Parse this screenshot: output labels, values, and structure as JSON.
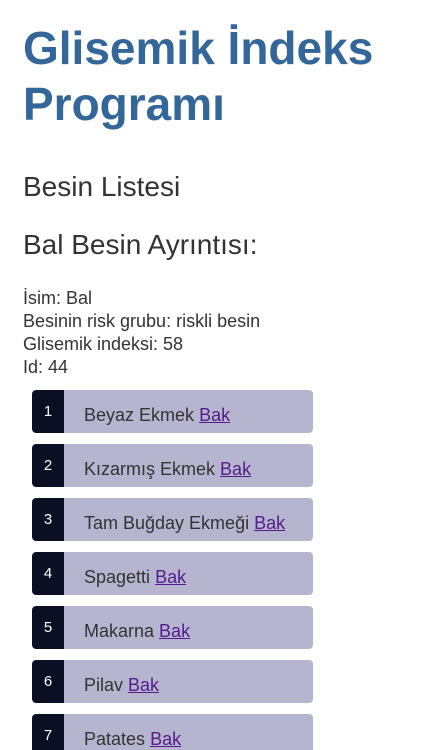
{
  "header": {
    "title": "Glisemik İndeks Programı"
  },
  "sections": {
    "list_heading": "Besin Listesi",
    "detail_heading": "Bal Besin Ayrıntısı:"
  },
  "detail": {
    "name_line": "İsim: Bal",
    "risk_line": "Besinin risk grubu: riskli besin",
    "gi_line": "Glisemik indeksi: 58",
    "id_line": "Id: 44"
  },
  "foods": [
    {
      "num": "1",
      "name": "Beyaz Ekmek",
      "link": "Bak"
    },
    {
      "num": "2",
      "name": "Kızarmış Ekmek",
      "link": "Bak"
    },
    {
      "num": "3",
      "name": "Tam Buğday Ekmeği",
      "link": "Bak"
    },
    {
      "num": "4",
      "name": "Spagetti",
      "link": "Bak"
    },
    {
      "num": "5",
      "name": "Makarna",
      "link": "Bak"
    },
    {
      "num": "6",
      "name": "Pilav",
      "link": "Bak"
    },
    {
      "num": "7",
      "name": "Patates",
      "link": "Bak"
    }
  ],
  "colors": {
    "title": "#336699",
    "number_badge": "#0a0f24",
    "item_background": "#b6b5d0",
    "link": "#551a8b"
  }
}
